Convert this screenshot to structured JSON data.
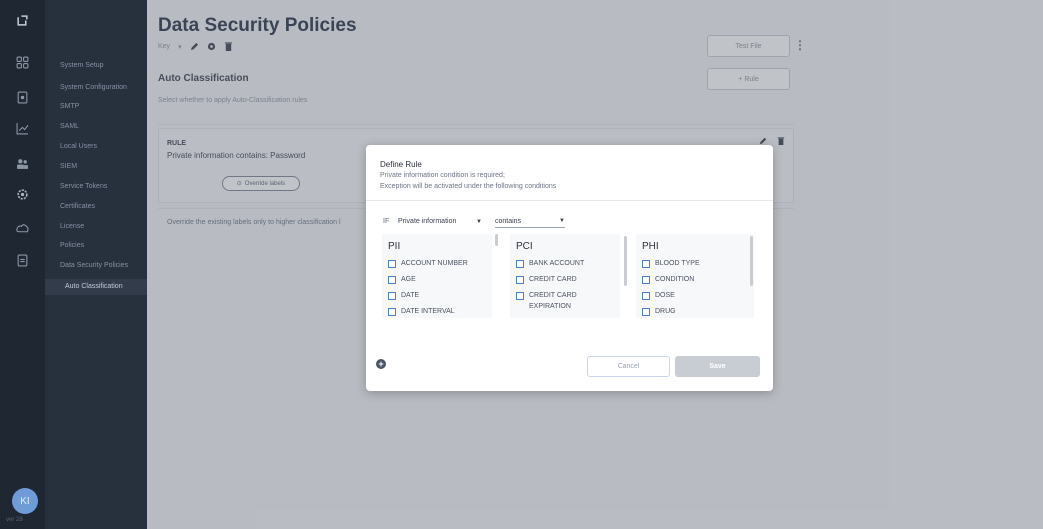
{
  "rail": {
    "icons": [
      "logo-icon",
      "dashboard-icon",
      "data-icon",
      "reports-icon",
      "users-icon",
      "settings-icon",
      "cloud-icon",
      "document-icon"
    ],
    "avatar": "KI",
    "version": "ver 28"
  },
  "nav": {
    "items": [
      "System Setup",
      "System Configuration",
      "SMTP",
      "SAML",
      "Local Users",
      "SIEM",
      "Service Tokens",
      "Certificates",
      "License",
      "Policies",
      "Data Security Policies",
      "Auto Classification"
    ]
  },
  "main": {
    "title": "Data Security Policies",
    "tag": "Key",
    "section_title": "Auto Classification",
    "section_desc": "Select whether to apply Auto-Classification rules",
    "test_file_label": "Test File",
    "add_rule_label": "+ Rule",
    "rule_title": "RULE",
    "rule_text": "Private information contains: Password",
    "override_labels": "Override labels",
    "override_text": "Override the existing labels only to higher classification l"
  },
  "modal": {
    "title": "Define Rule",
    "desc1": "Private information condition is required;",
    "desc2": "Exception will be activated under the following conditions",
    "if_label": "IF",
    "select1": "Private information",
    "select2": "contains",
    "columns": [
      {
        "heading": "PII",
        "items": [
          "ACCOUNT NUMBER",
          "AGE",
          "DATE",
          "DATE INTERVAL"
        ]
      },
      {
        "heading": "PCI",
        "items": [
          "BANK ACCOUNT",
          "CREDIT CARD",
          "CREDIT CARD EXPIRATION"
        ]
      },
      {
        "heading": "PHI",
        "items": [
          "BLOOD TYPE",
          "CONDITION",
          "DOSE",
          "DRUG"
        ]
      }
    ],
    "cancel_label": "Cancel",
    "save_label": "Save"
  },
  "colors": {
    "rail": "#1f2733",
    "nav": "#27303d",
    "checkbox": "#4d7fc9",
    "save_disabled": "#c8ccd3"
  }
}
